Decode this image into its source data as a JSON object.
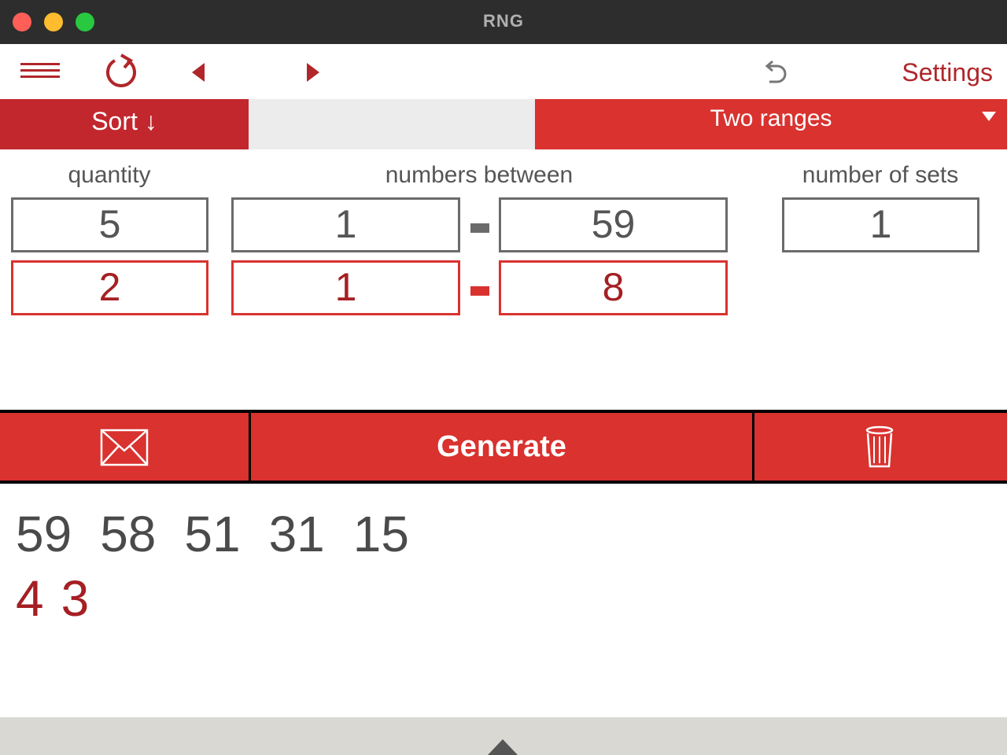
{
  "window": {
    "title": "RNG"
  },
  "toolbar": {
    "settings_label": "Settings"
  },
  "modebar": {
    "sort_label": "Sort ↓",
    "range_mode": "Two ranges"
  },
  "labels": {
    "quantity": "quantity",
    "numbers_between": "numbers between",
    "number_of_sets": "number of sets"
  },
  "range1": {
    "quantity": "5",
    "min": "1",
    "max": "59",
    "sets": "1"
  },
  "range2": {
    "quantity": "2",
    "min": "1",
    "max": "8"
  },
  "actions": {
    "generate_label": "Generate"
  },
  "results": {
    "main": [
      "59",
      "58",
      "51",
      "31",
      "15"
    ],
    "extra": [
      "4",
      "3"
    ]
  },
  "colors": {
    "accent": "#d9322f",
    "dark_red": "#b0262a",
    "titlebar": "#2d2d2d",
    "gray_border": "#6b6b6b"
  },
  "icons": [
    "menu-icon",
    "refresh-icon",
    "prev-arrow-icon",
    "next-arrow-icon",
    "undo-icon",
    "dropdown-arrow-icon",
    "envelope-icon",
    "trash-icon",
    "expand-up-icon"
  ]
}
